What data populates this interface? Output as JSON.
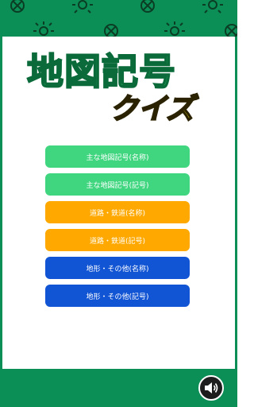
{
  "title": {
    "main": "地図記号",
    "sub": "クイズ"
  },
  "menu": {
    "buttons": [
      {
        "label": "主な地図記号(名称)",
        "color": "#3fd67f"
      },
      {
        "label": "主な地図記号(記号)",
        "color": "#3fd67f"
      },
      {
        "label": "道路・鉄道(名称)",
        "color": "#fea800"
      },
      {
        "label": "道路・鉄道(記号)",
        "color": "#fea800"
      },
      {
        "label": "地形・その他(名称)",
        "color": "#1154d4"
      },
      {
        "label": "地形・その他(記号)",
        "color": "#1154d4"
      }
    ]
  },
  "footer": {
    "sound_icon": "speaker-icon"
  },
  "colors": {
    "banner": "#0b8f57",
    "title_green": "#26d06a",
    "title_yellow": "#f6e81a"
  }
}
